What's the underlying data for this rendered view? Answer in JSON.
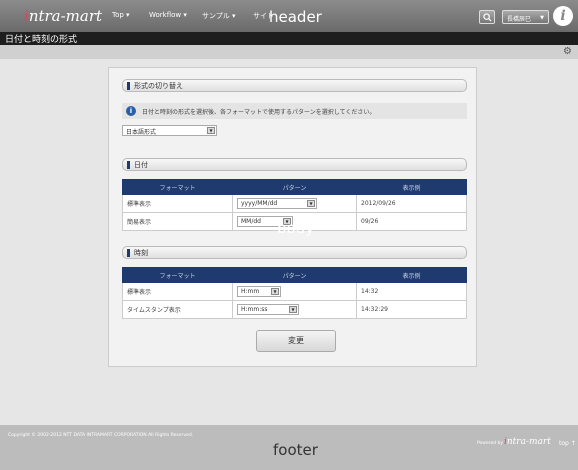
{
  "header": {
    "logo_prefix": "i",
    "logo_text": "ntra-mart",
    "nav": [
      "Top",
      "Workflow",
      "サンプル",
      "サイト"
    ],
    "tag": "header",
    "user": "長橋辰巳",
    "info_icon": "i-info-icon"
  },
  "titlebar": {
    "title": "日付と時刻の形式"
  },
  "body": {
    "tag": "body",
    "format_section": {
      "title": "形式の切り替え",
      "info": "日付と時刻の形式を選択後、各フォーマットで使用するパターンを選択してください。",
      "select_value": "日本語形式"
    },
    "date_section": {
      "title": "日付",
      "headers": [
        "フォーマット",
        "パターン",
        "表示例"
      ],
      "rows": [
        {
          "format": "標準表示",
          "pattern": "yyyy/MM/dd",
          "example": "2012/09/26"
        },
        {
          "format": "簡易表示",
          "pattern": "MM/dd",
          "example": "09/26"
        }
      ]
    },
    "time_section": {
      "title": "時刻",
      "headers": [
        "フォーマット",
        "パターン",
        "表示例"
      ],
      "rows": [
        {
          "format": "標準表示",
          "pattern": "H:mm",
          "example": "14:32"
        },
        {
          "format": "タイムスタンプ表示",
          "pattern": "H:mm:ss",
          "example": "14:32:29"
        }
      ]
    },
    "submit_label": "変更"
  },
  "footer": {
    "copyright": "Copyright © 2002-2012 NTT DATA INTRAMART CORPORATION All Rights Reserved.",
    "tag": "footer",
    "powered_by": "Powered by",
    "logo_prefix": "i",
    "logo_text": "ntra-mart",
    "top_link": "top ↑"
  }
}
